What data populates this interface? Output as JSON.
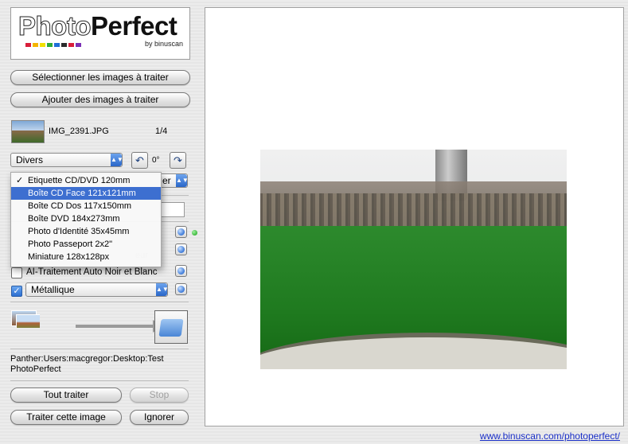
{
  "logo": {
    "photo": "Photo",
    "perfect": "Perfect",
    "by": "by binuscan",
    "swatch_colors": [
      "#d81e3a",
      "#f4b400",
      "#f1e000",
      "#2dab3a",
      "#1e6ed8",
      "#2a2a2a",
      "#d81e3a",
      "#7a2fb5"
    ]
  },
  "buttons": {
    "select_images": "Sélectionner les images à traiter",
    "add_images": "Ajouter des images à traiter",
    "process_all": "Tout traiter",
    "stop": "Stop",
    "process_this": "Traiter cette image",
    "ignore": "Ignorer"
  },
  "current_file": {
    "name": "IMG_2391.JPG",
    "counter": "1/4"
  },
  "preset_select": {
    "value": "Divers"
  },
  "rotation": {
    "value": "0°"
  },
  "format_select_partial": "er",
  "hidden_field_partial": "eur",
  "dropdown_menu": {
    "items": [
      {
        "label": "Etiquette CD/DVD 120mm",
        "checked": true,
        "highlighted": false
      },
      {
        "label": "Boîte CD Face 121x121mm",
        "checked": false,
        "highlighted": true
      },
      {
        "label": "Boîte CD Dos 117x150mm",
        "checked": false,
        "highlighted": false
      },
      {
        "label": "Boîte DVD 184x273mm",
        "checked": false,
        "highlighted": false
      },
      {
        "label": "Photo d'Identité 35x45mm",
        "checked": false,
        "highlighted": false
      },
      {
        "label": "Photo Passeport 2x2\"",
        "checked": false,
        "highlighted": false
      },
      {
        "label": "Miniature 128x128px",
        "checked": false,
        "highlighted": false
      }
    ]
  },
  "options": {
    "auto_bw_label": "AI-Traitement Auto Noir et Blanc",
    "auto_bw_checked": false,
    "effect_checked": true,
    "effect_select": "Métallique"
  },
  "output_path": "Panther:Users:macgregor:Desktop:Test PhotoPerfect",
  "footer_link": "www.binuscan.com/photoperfect/"
}
